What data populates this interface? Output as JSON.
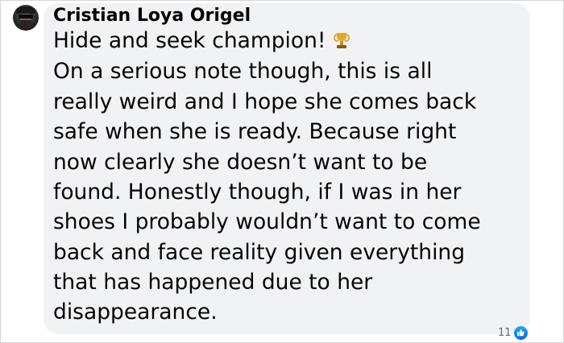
{
  "comment": {
    "author": "Cristian Loya Origel",
    "lines": [
      "Hide and seek champion!",
      "On a serious note though, this is all",
      "really weird and I hope she comes back",
      "safe when she is ready. Because right",
      "now clearly she doesn’t want to be",
      "found. Honestly though, if I was in her",
      "shoes I probably wouldn’t want to come",
      "back and face reality given everything",
      "that has happened due to her",
      "disappearance."
    ],
    "emoji": "trophy-icon",
    "reaction_count": "11",
    "reaction_icon": "like-icon",
    "colors": {
      "bubble": "#f0f2f5",
      "text": "#050505",
      "like": "#1877f2"
    }
  }
}
